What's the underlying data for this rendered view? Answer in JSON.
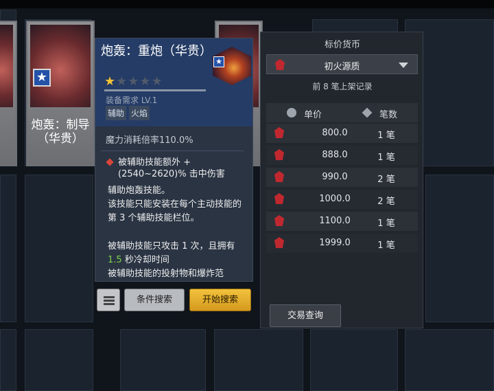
{
  "topbar": {
    "title": ""
  },
  "cards": [
    {
      "label_line1": "炮轰：制导",
      "label_line2": "（华贵）"
    }
  ],
  "tooltip": {
    "title": "炮轰：重炮（华贵）",
    "rating": "1 of 5 stars",
    "requirement": "装备需求 LV.1",
    "tags": [
      "辅助",
      "火焰"
    ],
    "mana": "魔力消耗倍率110.0%",
    "effect": "被辅助技能额外 +(2540~2620)% 击中伤害",
    "desc": [
      "辅助炮轰技能。",
      "该技能只能安装在每个主动技能的第 3 个辅助技能栏位。"
    ],
    "desc2_prefix": "被辅助技能只攻击 1 次，且拥有 ",
    "desc2_value": "1.5",
    "desc2_suffix": " 秒冷却时间",
    "desc3": "被辅助技能的投射物和爆炸范"
  },
  "buttons": {
    "filter": "条件搜索",
    "search": "开始搜索",
    "trade": "交易查询"
  },
  "panel": {
    "title": "标价货币",
    "currency": "初火源质",
    "subtitle": "前 8 笔上架记录",
    "col_price": "单价",
    "col_qty": "笔数",
    "rows": [
      {
        "price": "800.0",
        "qty": "1 笔"
      },
      {
        "price": "888.0",
        "qty": "1 笔"
      },
      {
        "price": "990.0",
        "qty": "2 笔"
      },
      {
        "price": "1000.0",
        "qty": "2 笔"
      },
      {
        "price": "1100.0",
        "qty": "1 笔"
      },
      {
        "price": "1999.0",
        "qty": "1 笔"
      }
    ]
  },
  "colors": {
    "accent": "#f3c23d",
    "currency_gem": "#c0282f",
    "star_on": "#f4c233",
    "highlight": "#7ed24a"
  }
}
